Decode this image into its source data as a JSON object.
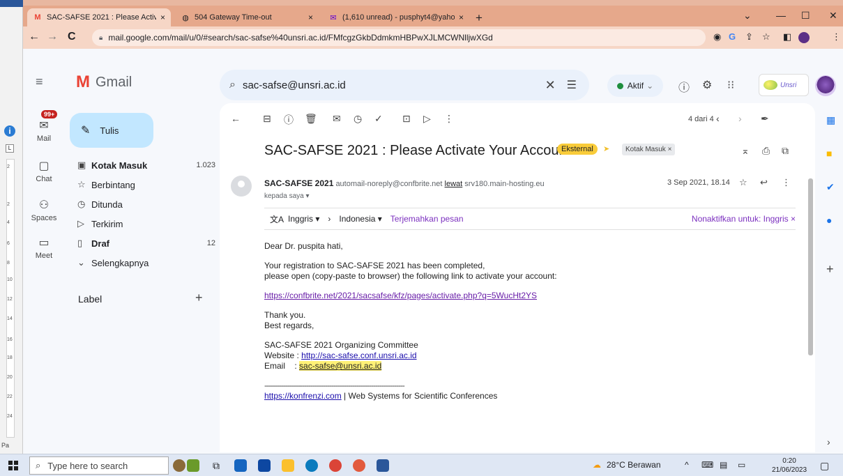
{
  "background_doc": {
    "ruler_numbers": [
      "2",
      "2",
      "4",
      "6",
      "8",
      "10",
      "12",
      "14",
      "16",
      "18",
      "20",
      "22",
      "24"
    ],
    "page_label": "Pa",
    "box_label": "L"
  },
  "browser": {
    "tabs": [
      {
        "icon": "gmail-icon",
        "title": "SAC-SAFSE 2021 : Please Activate",
        "close": "×",
        "active": true
      },
      {
        "icon": "globe-icon",
        "title": "504 Gateway Time-out",
        "close": "×",
        "active": false
      },
      {
        "icon": "mail-icon",
        "title": "(1,610 unread) - pusphyt4@yaho",
        "close": "×",
        "active": false
      }
    ],
    "new_tab": "+",
    "window_controls": {
      "dropdown": "⌄",
      "minimize": "—",
      "maximize": "☐",
      "close": "✕"
    },
    "url": "mail.google.com/mail/u/0/#search/sac-safse%40unsri.ac.id/FMfcgzGkbDdmkmHBPwXJLMCWNlljwXGd",
    "nav": {
      "back": "←",
      "forward": "→",
      "reload": "C"
    },
    "toolbar_icons": [
      "◉",
      "G",
      "⇪",
      "☆",
      "◧",
      "⋮"
    ]
  },
  "gmail": {
    "app_name": "Gmail",
    "search_value": "sac-safse@unsri.ac.id",
    "status_label": "Aktif",
    "rail": [
      {
        "icon": "mail-icon",
        "label": "Mail",
        "badge": "99+"
      },
      {
        "icon": "chat-icon",
        "label": "Chat"
      },
      {
        "icon": "spaces-icon",
        "label": "Spaces"
      },
      {
        "icon": "meet-icon",
        "label": "Meet"
      }
    ],
    "compose_label": "Tulis",
    "nav_items": [
      {
        "label": "Kotak Masuk",
        "count": "1.023",
        "bold": true
      },
      {
        "label": "Berbintang",
        "count": ""
      },
      {
        "label": "Ditunda",
        "count": ""
      },
      {
        "label": "Terkirim",
        "count": ""
      },
      {
        "label": "Draf",
        "count": "12",
        "bold": true
      },
      {
        "label": "Selengkapnya",
        "count": ""
      }
    ],
    "label_heading": "Label",
    "unsri_badge": "Unsri"
  },
  "message": {
    "count": "4 dari 4",
    "subject": "SAC-SAFSE 2021 : Please Activate Your Account",
    "tag_external": "Eksternal",
    "tag_inbox": "Kotak Masuk ×",
    "sender_name": "SAC-SAFSE 2021",
    "sender_email": "automail-noreply@confbrite.net",
    "via_word": "lewat",
    "via_host": "srv180.main-hosting.eu",
    "to_line": "kepada saya ▾",
    "date": "3 Sep 2021, 18.14",
    "translate": {
      "from": "Inggris ▾",
      "arrow": "›",
      "to": "Indonesia ▾",
      "link": "Terjemahkan pesan",
      "off": "Nonaktifkan untuk: Inggris ×"
    },
    "body": {
      "greeting": "Dear Dr. puspita hati,",
      "line1": "Your registration to SAC-SAFSE 2021 has been completed,",
      "line2": "please open (copy-paste to browser) the following link to activate your account:",
      "activation_link": "https://confbrite.net/2021/sacsafse/kfz/pages/activate.php?q=5WucHt2YS",
      "thanks": "Thank you.",
      "regards": "Best regards,",
      "committee": "SAC-SAFSE 2021 Organizing Committee",
      "website_label": "Website : ",
      "website_url": "http://sac-safse.conf.unsri.ac.id",
      "email_label": "Email    : ",
      "email_value": "sac-safse@unsri.ac.id",
      "separator": "-------------------------------------------------------------------",
      "footer_link": "https://konfrenzi.com",
      "footer_text": " | Web Systems for Scientific Conferences"
    }
  },
  "taskbar": {
    "search_placeholder": "Type here to search",
    "weather": "28°C Berawan",
    "time": "0:20",
    "date": "21/06/2023"
  }
}
